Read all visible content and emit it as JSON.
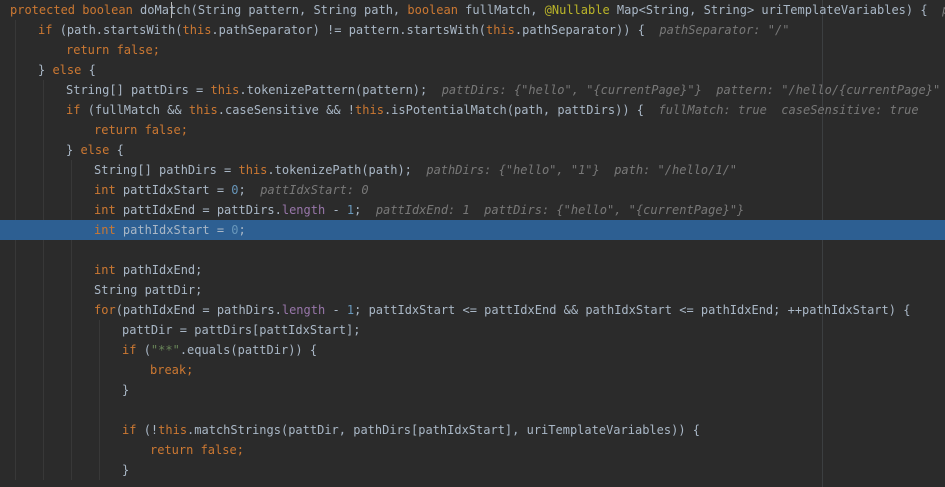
{
  "colors": {
    "background": "#2b2b2b",
    "keyword": "#cc7832",
    "text": "#a9b7c6",
    "string": "#6a8759",
    "number": "#6897bb",
    "hint": "#787878",
    "selection": "#2d5f92"
  },
  "editor": {
    "highlighted_line": 11,
    "lines": [
      {
        "indent": 0,
        "tokens": [
          {
            "t": "protected boolean ",
            "c": "kw"
          },
          {
            "t": "doMatch",
            "c": "fn"
          },
          {
            "t": "(String pattern, String path, ",
            "c": "plain"
          },
          {
            "t": "boolean ",
            "c": "kw"
          },
          {
            "t": "fullMatch, ",
            "c": "plain"
          },
          {
            "t": "@Nullable ",
            "c": "ann"
          },
          {
            "t": "Map<String, String> uriTemplateVariables) {  ",
            "c": "plain"
          },
          {
            "t": "patte",
            "c": "hint"
          }
        ]
      },
      {
        "indent": 1,
        "tokens": [
          {
            "t": "if ",
            "c": "kw"
          },
          {
            "t": "(path.startsWith(",
            "c": "plain"
          },
          {
            "t": "this",
            "c": "kw"
          },
          {
            "t": ".pathSeparator) != pattern.startsWith(",
            "c": "plain"
          },
          {
            "t": "this",
            "c": "kw"
          },
          {
            "t": ".pathSeparator)) {  ",
            "c": "plain"
          },
          {
            "t": "pathSeparator: \"/\"",
            "c": "hint"
          }
        ]
      },
      {
        "indent": 2,
        "tokens": [
          {
            "t": "return false;",
            "c": "kw"
          }
        ]
      },
      {
        "indent": 1,
        "tokens": [
          {
            "t": "} ",
            "c": "plain"
          },
          {
            "t": "else ",
            "c": "kw"
          },
          {
            "t": "{",
            "c": "plain"
          }
        ]
      },
      {
        "indent": 2,
        "tokens": [
          {
            "t": "String[] pattDirs = ",
            "c": "plain"
          },
          {
            "t": "this",
            "c": "kw"
          },
          {
            "t": ".tokenizePattern(pattern);  ",
            "c": "plain"
          },
          {
            "t": "pattDirs: {\"hello\", \"{currentPage}\"}  pattern: \"/hello/{currentPage}\"",
            "c": "hint"
          }
        ]
      },
      {
        "indent": 2,
        "tokens": [
          {
            "t": "if ",
            "c": "kw"
          },
          {
            "t": "(fullMatch && ",
            "c": "plain"
          },
          {
            "t": "this",
            "c": "kw"
          },
          {
            "t": ".caseSensitive && !",
            "c": "plain"
          },
          {
            "t": "this",
            "c": "kw"
          },
          {
            "t": ".isPotentialMatch(path, pattDirs)) {  ",
            "c": "plain"
          },
          {
            "t": "fullMatch: true  caseSensitive: true",
            "c": "hint"
          }
        ]
      },
      {
        "indent": 3,
        "tokens": [
          {
            "t": "return false;",
            "c": "kw"
          }
        ]
      },
      {
        "indent": 2,
        "tokens": [
          {
            "t": "} ",
            "c": "plain"
          },
          {
            "t": "else ",
            "c": "kw"
          },
          {
            "t": "{",
            "c": "plain"
          }
        ]
      },
      {
        "indent": 3,
        "tokens": [
          {
            "t": "String[] pathDirs = ",
            "c": "plain"
          },
          {
            "t": "this",
            "c": "kw"
          },
          {
            "t": ".tokenizePath(path);  ",
            "c": "plain"
          },
          {
            "t": "pathDirs: {\"hello\", \"1\"}  path: \"/hello/1/\"",
            "c": "hint"
          }
        ]
      },
      {
        "indent": 3,
        "tokens": [
          {
            "t": "int ",
            "c": "kw"
          },
          {
            "t": "pattIdxStart = ",
            "c": "plain"
          },
          {
            "t": "0",
            "c": "num"
          },
          {
            "t": ";  ",
            "c": "plain"
          },
          {
            "t": "pattIdxStart: 0",
            "c": "hint"
          }
        ]
      },
      {
        "indent": 3,
        "tokens": [
          {
            "t": "int ",
            "c": "kw"
          },
          {
            "t": "pattIdxEnd = pattDirs.",
            "c": "plain"
          },
          {
            "t": "length ",
            "c": "field"
          },
          {
            "t": "- ",
            "c": "plain"
          },
          {
            "t": "1",
            "c": "num"
          },
          {
            "t": ";  ",
            "c": "plain"
          },
          {
            "t": "pattIdxEnd: 1  pattDirs: {\"hello\", \"{currentPage}\"}",
            "c": "hint"
          }
        ]
      },
      {
        "indent": 3,
        "tokens": [
          {
            "t": "int ",
            "c": "kw"
          },
          {
            "t": "pathIdxStart = ",
            "c": "plain"
          },
          {
            "t": "0",
            "c": "num"
          },
          {
            "t": ";",
            "c": "plain"
          }
        ]
      },
      {
        "indent": 0,
        "tokens": []
      },
      {
        "indent": 3,
        "tokens": [
          {
            "t": "int ",
            "c": "kw"
          },
          {
            "t": "pathIdxEnd;",
            "c": "plain"
          }
        ]
      },
      {
        "indent": 3,
        "tokens": [
          {
            "t": "String pattDir;",
            "c": "plain"
          }
        ]
      },
      {
        "indent": 3,
        "tokens": [
          {
            "t": "for",
            "c": "kw"
          },
          {
            "t": "(pathIdxEnd = pathDirs.",
            "c": "plain"
          },
          {
            "t": "length ",
            "c": "field"
          },
          {
            "t": "- ",
            "c": "plain"
          },
          {
            "t": "1",
            "c": "num"
          },
          {
            "t": "; pattIdxStart <= pattIdxEnd && pathIdxStart <= pathIdxEnd; ++pathIdxStart) {",
            "c": "plain"
          }
        ]
      },
      {
        "indent": 4,
        "tokens": [
          {
            "t": "pattDir = pattDirs[pattIdxStart];",
            "c": "plain"
          }
        ]
      },
      {
        "indent": 4,
        "tokens": [
          {
            "t": "if ",
            "c": "kw"
          },
          {
            "t": "(",
            "c": "plain"
          },
          {
            "t": "\"**\"",
            "c": "str"
          },
          {
            "t": ".equals(pattDir)) {",
            "c": "plain"
          }
        ]
      },
      {
        "indent": 5,
        "tokens": [
          {
            "t": "break;",
            "c": "kw"
          }
        ]
      },
      {
        "indent": 4,
        "tokens": [
          {
            "t": "}",
            "c": "plain"
          }
        ]
      },
      {
        "indent": 0,
        "tokens": []
      },
      {
        "indent": 4,
        "tokens": [
          {
            "t": "if ",
            "c": "kw"
          },
          {
            "t": "(!",
            "c": "plain"
          },
          {
            "t": "this",
            "c": "kw"
          },
          {
            "t": ".matchStrings(pattDir, pathDirs[pathIdxStart], uriTemplateVariables)) {",
            "c": "plain"
          }
        ]
      },
      {
        "indent": 5,
        "tokens": [
          {
            "t": "return false;",
            "c": "kw"
          }
        ]
      },
      {
        "indent": 4,
        "tokens": [
          {
            "t": "}",
            "c": "plain"
          }
        ]
      }
    ]
  }
}
